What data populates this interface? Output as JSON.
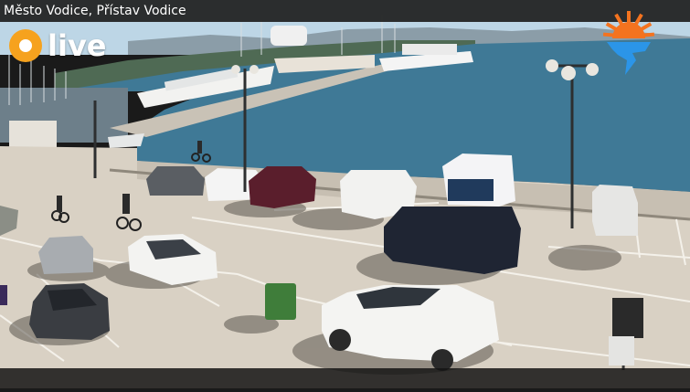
{
  "header": {
    "title": "Město Vodice, Přístav Vodice"
  },
  "badge": {
    "live_label": "live",
    "dot_color": "#f6a21e"
  },
  "logo": {
    "icon": "sun-wave-logo-icon",
    "sun_color": "#f4731f",
    "wave_color": "#2b95e8"
  },
  "colors": {
    "sea": "#3f7996",
    "sky": "#b9d4e4",
    "pavement": "#d9d1c4"
  }
}
